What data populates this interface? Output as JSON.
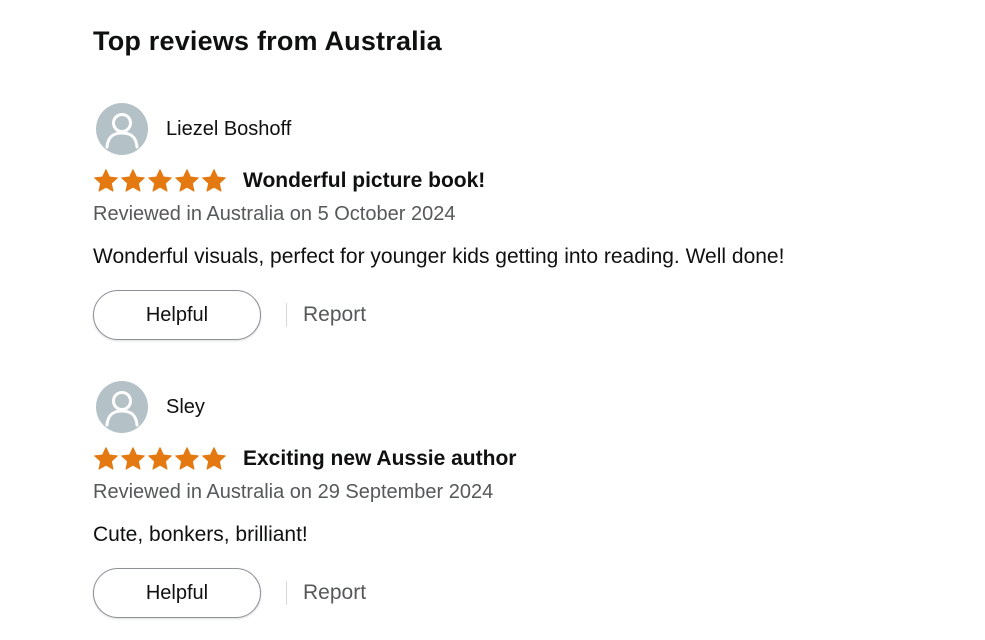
{
  "section": {
    "title": "Top reviews from Australia"
  },
  "colors": {
    "star": "#e47911",
    "avatar_bg": "#b4c1c6",
    "text": "#0f1111",
    "muted": "#565959"
  },
  "reviews": [
    {
      "reviewer": "Liezel Boshoff",
      "avatar_icon": "default-user-avatar",
      "rating": 5,
      "rating_max": 5,
      "title": "Wonderful picture book!",
      "date": "Reviewed in Australia on 5 October 2024",
      "body": "Wonderful visuals, perfect for younger kids getting into reading. Well done!",
      "helpful_label": "Helpful",
      "report_label": "Report"
    },
    {
      "reviewer": "Sley",
      "avatar_icon": "default-user-avatar",
      "rating": 5,
      "rating_max": 5,
      "title": "Exciting new Aussie author",
      "date": "Reviewed in Australia on 29 September 2024",
      "body": "Cute, bonkers, brilliant!",
      "helpful_label": "Helpful",
      "report_label": "Report"
    }
  ]
}
